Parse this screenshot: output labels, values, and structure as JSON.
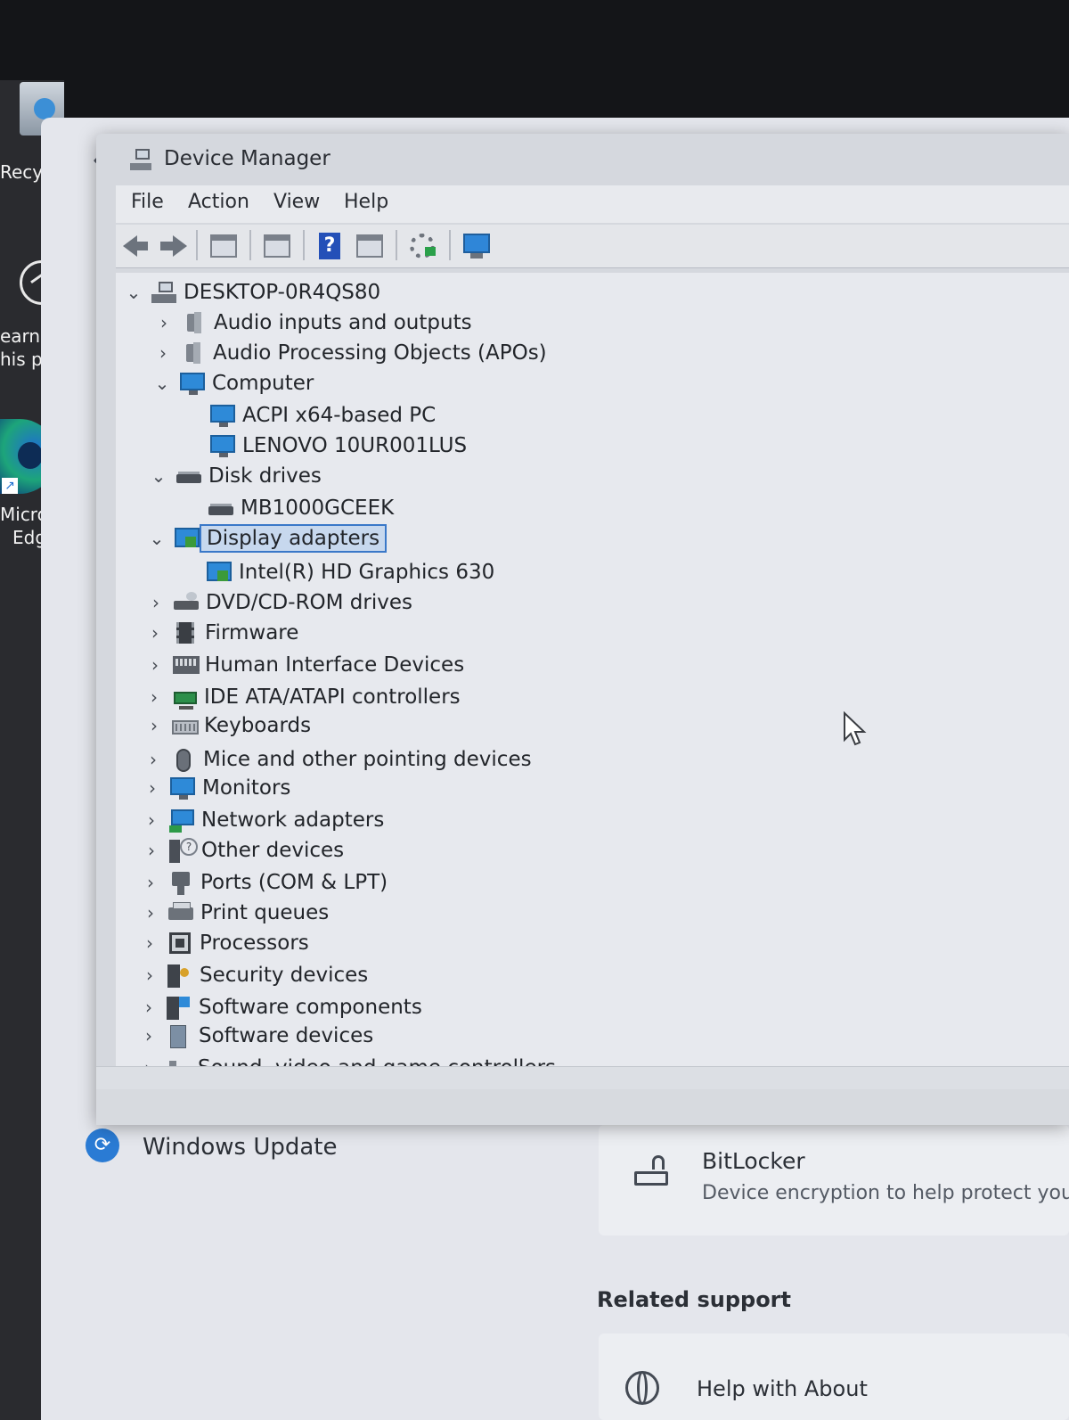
{
  "desktop": {
    "icons": [
      {
        "label": "Recycle",
        "icon": "recycle-bin-icon"
      },
      {
        "label_line1": "earn al",
        "label_line2": "his pic",
        "icon": "learn-about-picture-icon"
      },
      {
        "label_line1": "Micros",
        "label_line2": "Edge",
        "icon": "edge-icon"
      }
    ]
  },
  "settings": {
    "windows_update": {
      "label": "Windows Update",
      "icon": "windows-update-icon"
    },
    "bitlocker": {
      "title": "BitLocker",
      "subtitle": "Device encryption to help protect you",
      "icon": "lock-icon"
    },
    "related_support": {
      "heading": "Related support"
    },
    "help_with": {
      "label": "Help with About",
      "icon": "globe-icon"
    }
  },
  "device_manager": {
    "title": "Device Manager",
    "menu": [
      "File",
      "Action",
      "View",
      "Help"
    ],
    "toolbar": [
      "back-icon",
      "forward-icon",
      "console-tree-icon",
      "properties-icon",
      "help-icon",
      "action-pane-icon",
      "update-driver-icon",
      "scan-hardware-icon"
    ],
    "tree": {
      "root": "DESKTOP-0R4QS80",
      "items": [
        {
          "label": "Audio inputs and outputs",
          "expanded": false,
          "icon": "speaker-icon"
        },
        {
          "label": "Audio Processing Objects (APOs)",
          "expanded": false,
          "icon": "speaker-icon"
        },
        {
          "label": "Computer",
          "expanded": true,
          "icon": "monitor-icon"
        },
        {
          "label": "ACPI x64-based PC",
          "child": true,
          "icon": "monitor-icon"
        },
        {
          "label": "LENOVO 10UR001LUS",
          "child": true,
          "icon": "monitor-icon"
        },
        {
          "label": "Disk drives",
          "expanded": true,
          "icon": "disk-icon"
        },
        {
          "label": "MB1000GCEEK",
          "child": true,
          "icon": "disk-icon"
        },
        {
          "label": "Display adapters",
          "expanded": true,
          "selected": true,
          "icon": "display-adapter-icon"
        },
        {
          "label": "Intel(R) HD Graphics 630",
          "child": true,
          "icon": "display-adapter-icon"
        },
        {
          "label": "DVD/CD-ROM drives",
          "expanded": false,
          "icon": "dvd-icon"
        },
        {
          "label": "Firmware",
          "expanded": false,
          "icon": "firmware-icon"
        },
        {
          "label": "Human Interface Devices",
          "expanded": false,
          "icon": "hid-icon"
        },
        {
          "label": "IDE ATA/ATAPI controllers",
          "expanded": false,
          "icon": "ide-icon"
        },
        {
          "label": "Keyboards",
          "expanded": false,
          "icon": "keyboard-icon"
        },
        {
          "label": "Mice and other pointing devices",
          "expanded": false,
          "icon": "mouse-icon"
        },
        {
          "label": "Monitors",
          "expanded": false,
          "icon": "monitor-icon"
        },
        {
          "label": "Network adapters",
          "expanded": false,
          "icon": "network-icon"
        },
        {
          "label": "Other devices",
          "expanded": false,
          "icon": "other-devices-icon"
        },
        {
          "label": "Ports (COM & LPT)",
          "expanded": false,
          "icon": "port-icon"
        },
        {
          "label": "Print queues",
          "expanded": false,
          "icon": "printer-icon"
        },
        {
          "label": "Processors",
          "expanded": false,
          "icon": "processor-icon"
        },
        {
          "label": "Security devices",
          "expanded": false,
          "icon": "security-icon"
        },
        {
          "label": "Software components",
          "expanded": false,
          "icon": "software-components-icon"
        },
        {
          "label": "Software devices",
          "expanded": false,
          "icon": "software-devices-icon"
        },
        {
          "label": "Sound, video and game controllers",
          "expanded": false,
          "icon": "sound-icon"
        }
      ]
    }
  }
}
